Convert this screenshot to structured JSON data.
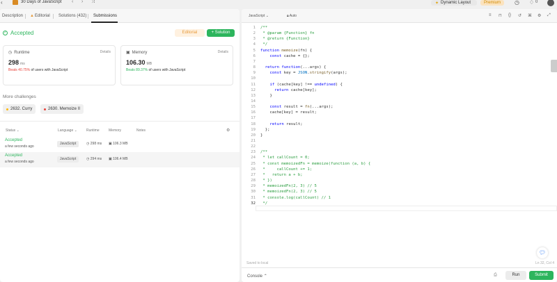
{
  "topbar": {
    "title": "30 Days of JavaScript",
    "dynamic_layout": "Dynamic Layout",
    "premium": "Premium",
    "count": "0"
  },
  "tabs": {
    "description": "Description",
    "editorial": "Editorial",
    "solutions": "Solutions (432)",
    "submissions": "Submissions"
  },
  "result": {
    "status": "Accepted",
    "editorial_btn": "Editorial",
    "solution_btn": "+ Solution"
  },
  "runtime": {
    "label": "Runtime",
    "details": "Details",
    "value": "298",
    "unit": "ms",
    "beats_pct": "Beats 40.75%",
    "beats_rest": " of users with JavaScript"
  },
  "memory": {
    "label": "Memory",
    "details": "Details",
    "value": "106.30",
    "unit": "MB",
    "beats_pct": "Beats 89.37%",
    "beats_rest": " of users with JavaScript"
  },
  "more_challenges": {
    "heading": "More challenges",
    "items": [
      "2632. Curry",
      "2630. Memoize II"
    ],
    "colors": [
      "#ffb800",
      "#e8433b"
    ]
  },
  "table": {
    "headers": [
      "Status",
      "Language",
      "Runtime",
      "Memory",
      "Notes"
    ],
    "rows": [
      {
        "status": "Accepted",
        "time": "a few seconds ago",
        "language": "JavaScript",
        "runtime": "298 ms",
        "memory": "106.3 MB"
      },
      {
        "status": "Accepted",
        "time": "a few seconds ago",
        "language": "JavaScript",
        "runtime": "294 ms",
        "memory": "106.4 MB"
      }
    ]
  },
  "editor": {
    "language": "JavaScript",
    "autocomplete": "Auto",
    "saved": "Saved to local",
    "position": "Ln 32, Col 4",
    "console": "Console",
    "run": "Run",
    "submit": "Submit",
    "lines": [
      "/**",
      " * @param {Function} fn",
      " * @return {Function}",
      " */",
      "function memoize(fn) {",
      "    const cache = {};",
      "",
      "  return function(...args) {",
      "    const key = JSON.stringify(args);",
      "",
      "    if (cache[key] !== undefined) {",
      "      return cache[key];",
      "    }",
      "",
      "    const result = fn(...args);",
      "    cache[key] = result;",
      "",
      "    return result;",
      "  };",
      "}",
      "",
      "",
      "/**",
      " * let callCount = 0;",
      " * const memoizedFn = memoize(function (a, b) {",
      " *     callCount += 1;",
      " *   return a + b;",
      " * })",
      " * memoizedFn(2, 3) // 5",
      " * memoizedFn(2, 3) // 5",
      " * console.log(callCount) // 1",
      " */"
    ]
  }
}
